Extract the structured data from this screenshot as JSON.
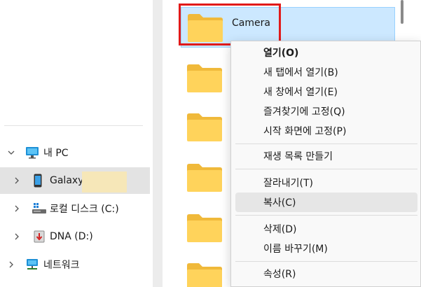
{
  "nav": {
    "items": [
      {
        "label": "내 PC",
        "icon": "monitor-icon",
        "expanded": true
      },
      {
        "label": "Galaxy",
        "icon": "phone-icon",
        "selected": true
      },
      {
        "label": "로컬 디스크 (C:)",
        "icon": "drive-icon"
      },
      {
        "label": "DNA (D:)",
        "icon": "usb-drive-icon"
      },
      {
        "label": "네트워크",
        "icon": "network-icon"
      }
    ]
  },
  "files": [
    {
      "name": "Camera",
      "selected": true
    },
    {
      "name": ""
    },
    {
      "name": ""
    },
    {
      "name": ""
    },
    {
      "name": ""
    },
    {
      "name": ""
    }
  ],
  "context_menu": {
    "items": [
      "열기(O)",
      "새 탭에서 열기(B)",
      "새 창에서 열기(E)",
      "즐겨찾기에 고정(Q)",
      "시작 화면에 고정(P)",
      "재생 목록 만들기",
      "잘라내기(T)",
      "복사(C)",
      "삭제(D)",
      "이름 바꾸기(M)",
      "속성(R)"
    ]
  },
  "colors": {
    "selection": "#cce8ff",
    "highlight": "#e11a1a",
    "folder": "#ffd35b"
  }
}
